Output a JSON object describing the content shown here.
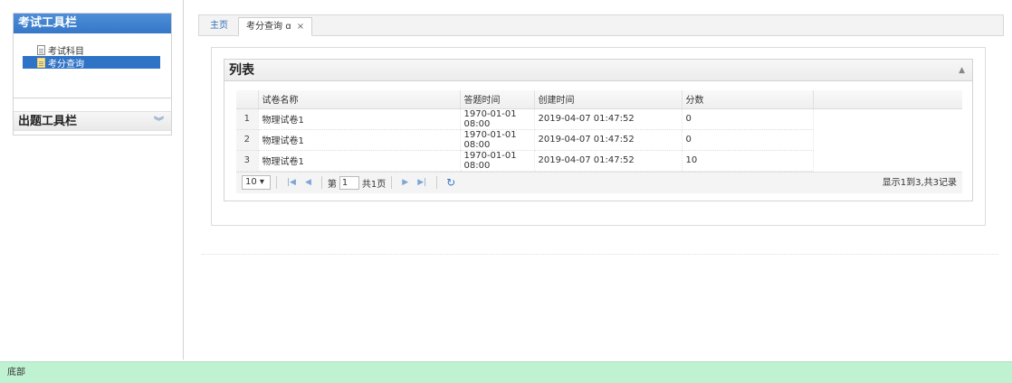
{
  "sidebar": {
    "exam_toolbar_title": "考试工具栏",
    "items": [
      {
        "label": "考试科目",
        "selected": false
      },
      {
        "label": "考分查询",
        "selected": true
      }
    ],
    "question_toolbar_title": "出题工具栏",
    "question_toolbar_icon": "double-chevron-down-icon"
  },
  "tabs": {
    "home_label": "主页",
    "active_label": "考分查询",
    "active_refresh": "ɑ",
    "close_glyph": "×"
  },
  "panel": {
    "title": "列表",
    "collapse_glyph": "▲"
  },
  "grid": {
    "columns": [
      "试卷名称",
      "答题时间",
      "创建时间",
      "分数"
    ],
    "rows": [
      {
        "num": "1",
        "name": "物理试卷1",
        "answer_time": "1970-01-01 08:00",
        "created": "2019-04-07 01:47:52",
        "score": "0"
      },
      {
        "num": "2",
        "name": "物理试卷1",
        "answer_time": "1970-01-01 08:00",
        "created": "2019-04-07 01:47:52",
        "score": "0"
      },
      {
        "num": "3",
        "name": "物理试卷1",
        "answer_time": "1970-01-01 08:00",
        "created": "2019-04-07 01:47:52",
        "score": "10"
      }
    ]
  },
  "pager": {
    "page_size": "10 ▾",
    "page_prefix": "第",
    "page_value": "1",
    "page_suffix": "共1页",
    "info": "显示1到3,共3记录"
  },
  "footer": {
    "text": "底部"
  }
}
